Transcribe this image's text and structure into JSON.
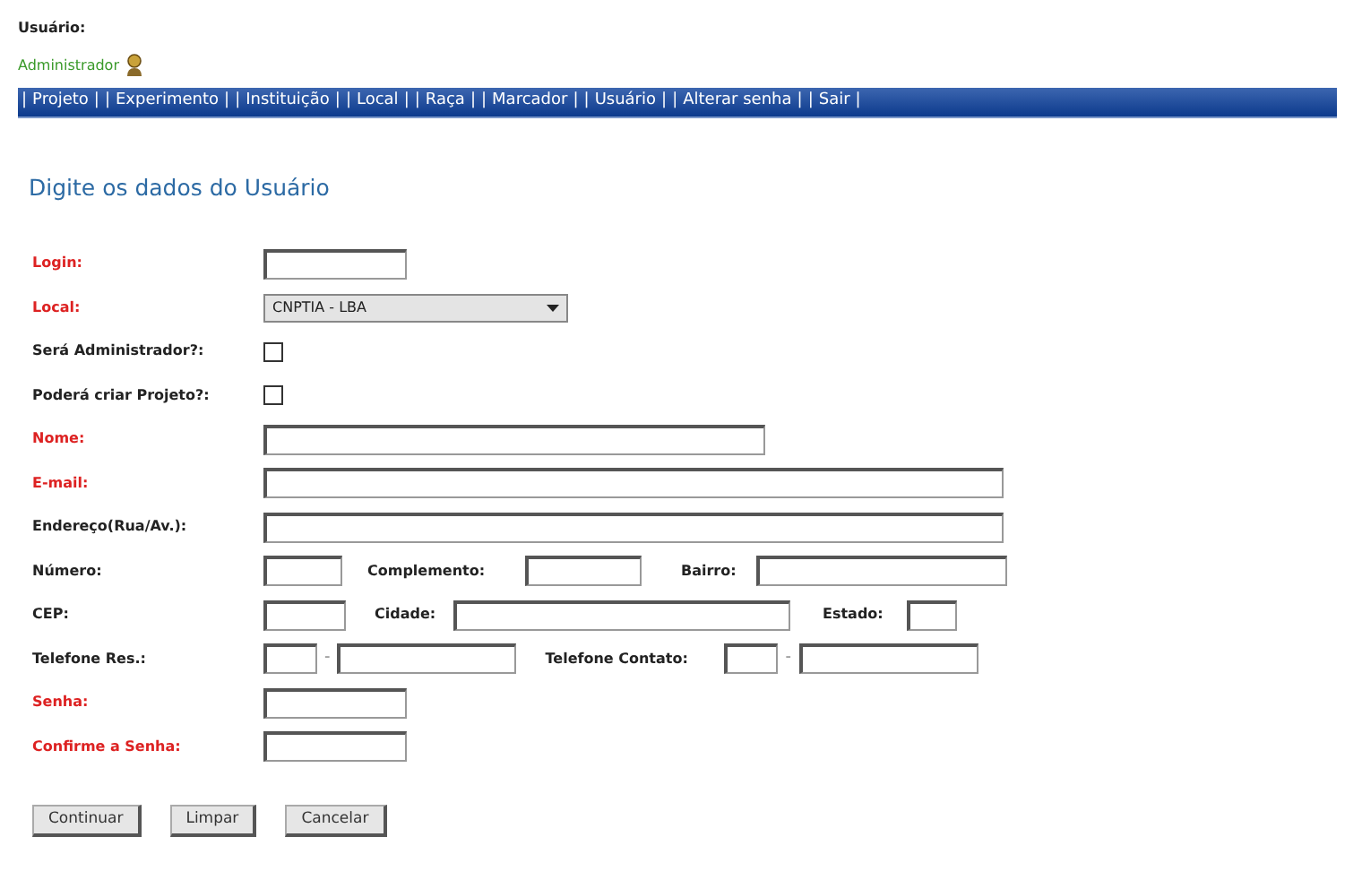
{
  "user": {
    "label": "Usuário:",
    "role": "Administrador"
  },
  "menu": {
    "separator": "|",
    "items": [
      "Projeto",
      "Experimento",
      "Instituição",
      "Local",
      "Raça",
      "Marcador",
      "Usuário",
      "Alterar senha",
      "Sair"
    ]
  },
  "title": "Digite os dados do Usuário",
  "rows": [
    [
      {
        "kind": "text",
        "label": "Login:",
        "required": true
      }
    ],
    [
      {
        "kind": "select",
        "label": "Local:",
        "required": true,
        "value": "CNPTIA - LBA"
      }
    ],
    [
      {
        "kind": "checkbox",
        "label": "Será Administrador?:",
        "required": false,
        "checked": false
      }
    ],
    [
      {
        "kind": "checkbox",
        "label": "Poderá criar Projeto?:",
        "required": false,
        "checked": false
      }
    ],
    [
      {
        "kind": "text",
        "label": "Nome:",
        "required": true
      }
    ],
    [
      {
        "kind": "text",
        "label": "E-mail:",
        "required": true
      }
    ],
    [
      {
        "kind": "text",
        "label": "Endereço(Rua/Av.):",
        "required": false
      }
    ],
    [
      {
        "kind": "text",
        "label": "Número:",
        "required": false
      },
      {
        "kind": "text",
        "label": "Complemento:",
        "required": false
      },
      {
        "kind": "text",
        "label": "Bairro:",
        "required": false
      }
    ],
    [
      {
        "kind": "text",
        "label": "CEP:",
        "required": false
      },
      {
        "kind": "text",
        "label": "Cidade:",
        "required": false
      },
      {
        "kind": "text",
        "label": "Estado:",
        "required": false
      }
    ],
    [
      {
        "kind": "phone",
        "label": "Telefone Res.:",
        "required": false,
        "dash": "-"
      },
      {
        "kind": "phone",
        "label": "Telefone Contato:",
        "required": false,
        "dash": "-"
      }
    ],
    [
      {
        "kind": "text",
        "label": "Senha:",
        "required": true
      }
    ],
    [
      {
        "kind": "text",
        "label": "Confirme a Senha:",
        "required": true
      }
    ]
  ],
  "buttons": [
    "Continuar",
    "Limpar",
    "Cancelar"
  ]
}
